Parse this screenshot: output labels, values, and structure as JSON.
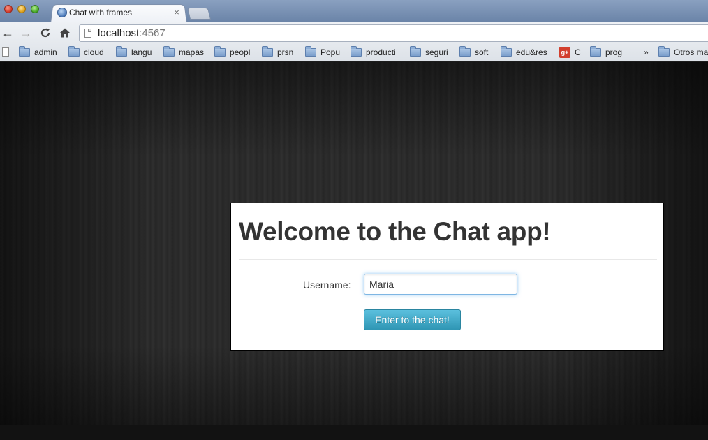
{
  "browser": {
    "tab_title": "Chat with frames",
    "tab_close": "×",
    "url_host": "localhost",
    "url_port": ":4567",
    "bookmarks": [
      {
        "label": "admin",
        "icon": "folder-icon"
      },
      {
        "label": "cloud",
        "icon": "folder-icon"
      },
      {
        "label": "langu",
        "icon": "folder-icon"
      },
      {
        "label": "mapas",
        "icon": "folder-icon"
      },
      {
        "label": "peopl",
        "icon": "folder-icon"
      },
      {
        "label": "prsn",
        "icon": "folder-icon"
      },
      {
        "label": "Popu",
        "icon": "folder-icon"
      },
      {
        "label": "producti",
        "icon": "folder-icon"
      },
      {
        "label": "seguri",
        "icon": "folder-icon"
      },
      {
        "label": "soft",
        "icon": "folder-icon"
      },
      {
        "label": "edu&res",
        "icon": "folder-icon"
      },
      {
        "label": "C",
        "icon": "google-plus-icon"
      },
      {
        "label": "prog",
        "icon": "folder-icon"
      }
    ],
    "bookmarks_overflow": "»",
    "other_bookmarks": "Otros ma"
  },
  "page": {
    "title": "Welcome to the Chat app!",
    "username_label": "Username:",
    "username_value": "Maria",
    "submit_label": "Enter to the chat!"
  },
  "colors": {
    "button_accent": "#2f96b4",
    "input_focus": "#52a8ec"
  }
}
